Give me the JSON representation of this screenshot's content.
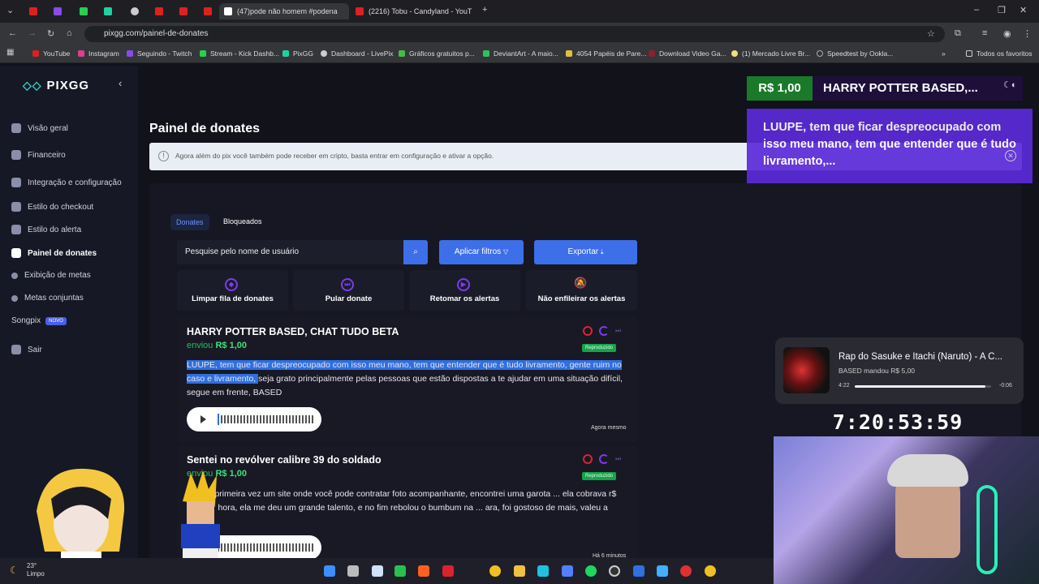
{
  "browser": {
    "tabs": [
      {
        "title": "(47)pode não homem #podena"
      },
      {
        "title": "(2216) Tobu - Candyland - YouT"
      }
    ],
    "url": "pixgg.com/painel-de-donates",
    "bookmarks": [
      "YouTube",
      "Instagram",
      "Seguindo - Twitch",
      "Stream - Kick Dashb...",
      "PixGG",
      "Dashboard - LivePix",
      "Gráficos gratuitos p...",
      "DeviantArt - A maio...",
      "4054 Papéis de Pare...",
      "Download Video Ga...",
      "(1) Mercado Livre Br...",
      "Speedtest by Ookla...",
      "Todos os favoritos"
    ]
  },
  "sidebar": {
    "brand": "PIXGG",
    "items": [
      {
        "label": "Visão geral"
      },
      {
        "label": "Financeiro"
      },
      {
        "label": "Integração e configuração"
      },
      {
        "label": "Estilo do checkout"
      },
      {
        "label": "Estilo do alerta"
      },
      {
        "label": "Painel de donates"
      },
      {
        "label": "Exibição de metas"
      },
      {
        "label": "Metas conjuntas"
      },
      {
        "label": "Songpix"
      },
      {
        "label": "Sair"
      }
    ],
    "songpix_badge": "NOVO"
  },
  "page": {
    "title": "Painel de donates",
    "notice": "Agora além do pix você também pode receber em cripto, basta entrar em configuração e ativar a opção.",
    "tabs": [
      "Donates",
      "Bloqueados"
    ],
    "search_placeholder": "Pesquise pelo nome de usuário",
    "filter_button": "Aplicar filtros",
    "export_button": "Exportar",
    "actions": [
      "Limpar fila de donates",
      "Pular donate",
      "Retomar os alertas",
      "Não enfileirar os alertas"
    ]
  },
  "donations": [
    {
      "name": "HARRY POTTER BASED, CHAT TUDO BETA",
      "sent_prefix": "enviou",
      "amount": "R$ 1,00",
      "status": "Reproduzido",
      "message_highlight": "LUUPE, tem que ficar despreocupado com isso meu mano, tem que entender que é tudo livramento, gente ruim no caso e livramento, ",
      "message_rest": "seja grato principalmente pelas pessoas que estão dispostas a te ajudar em uma situação difícil, segue em frente, BASED",
      "time": "Agora mesmo"
    },
    {
      "name": "Sentei no revólver calibre 39 do soldado",
      "sent_prefix": "enviou",
      "amount": "R$ 1,00",
      "status": "Reproduzido",
      "message": "... pela primeira vez um site onde você pode contratar foto acompanhante, encontrei uma garota ... ela cobrava r$ 500 por hora, ela me deu um grande talento, e no fim rebolou o bumbum na ... ara, foi gostoso de mais, valeu a pena?",
      "time": "Há 6 minutos"
    }
  ],
  "overlay": {
    "amount": "R$ 1,00",
    "name": "HARRY POTTER BASED,...",
    "message": "LUUPE, tem que ficar despreocupado com isso meu mano, tem que entender que é tudo livramento,..."
  },
  "music": {
    "title": "Rap do Sasuke e Itachi (Naruto) - A C...",
    "subtitle": "BASED mandou R$ 5,00",
    "elapsed": "4:22",
    "remaining": "-0:06",
    "progress": 0.96
  },
  "timer": "7:20:53:59",
  "taskbar": {
    "temp": "23°",
    "weather": "Limpo"
  },
  "colors": {
    "accent": "#3d6fe8",
    "purple": "#7a3cf0",
    "green": "#25c05a"
  }
}
